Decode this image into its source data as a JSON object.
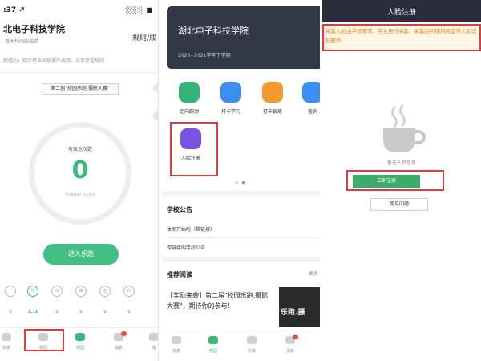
{
  "panel1": {
    "status_time": ":37 ↗",
    "status_icons": "░░░ ■",
    "school_name": "北电子科技学院",
    "subtitle": "暂无校内跑成绩",
    "rules_link": "规则/成",
    "hint": "跑成功，跑步将会关联课外成绩，点击查看规则",
    "banner": "第二届\"校园乐跑.摄影大赛\"",
    "ring_label": "有效总次数",
    "ring_value": "0",
    "ring_goal": "学期目标 0/60次",
    "enter_button": "进入乐跑",
    "days": [
      "一",
      "二",
      "三",
      "四",
      "五",
      "六"
    ],
    "day_values": [
      "0",
      "1.31",
      "0",
      "0",
      "0",
      "0"
    ],
    "nav": [
      "动态",
      "校园",
      "校园",
      "消息",
      "我"
    ]
  },
  "panel2": {
    "school_name": "湖北电子科技学院",
    "term": "2020~2021学年下学期",
    "tiles": [
      "定向跑动",
      "打卡学习",
      "打卡锻炼",
      "查询"
    ],
    "face_tile": "人脸注册",
    "school_notice_title": "学校公告",
    "notices": [
      "体测开始啦（带链接）",
      "带链接的学校公告"
    ],
    "reading_title": "推荐阅读",
    "more": "更多",
    "article": "【奖励来袭】第二届\"校园乐跑.摄影大赛\"，期待你的参与！",
    "thumb_text": "乐跑.摄",
    "nav": [
      "动态",
      "校园",
      "乐跑",
      "消息"
    ]
  },
  "panel3": {
    "title": "人脸注册",
    "notice": "采集人脸由学校要求，学生自行采集，采集后可使用阅室等人脸识别服务",
    "empty_text": "暂无人脸信息",
    "register_button": "立即注册",
    "faq_button": "常见问题"
  },
  "colors": {
    "accent_green": "#3cba7a",
    "highlight_red": "#e5393a",
    "header_dark": "#343846",
    "notice_orange": "#e8841c"
  }
}
